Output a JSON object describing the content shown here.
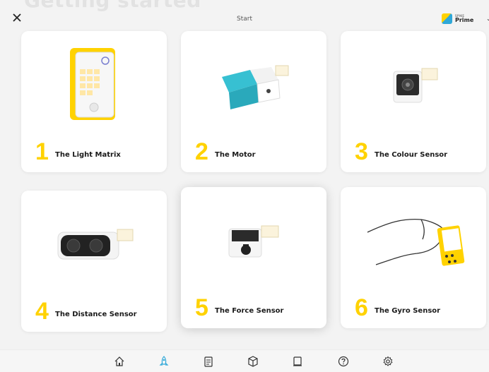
{
  "background_heading": "Getting started",
  "header": {
    "title": "Start",
    "logo_small": "SPIKE",
    "logo_big": "Prime"
  },
  "cards": [
    {
      "number": "1",
      "label": "The Light Matrix"
    },
    {
      "number": "2",
      "label": "The Motor"
    },
    {
      "number": "3",
      "label": "The Colour Sensor"
    },
    {
      "number": "4",
      "label": "The Distance Sensor"
    },
    {
      "number": "5",
      "label": "The Force Sensor"
    },
    {
      "number": "6",
      "label": "The Gyro Sensor"
    }
  ],
  "nav": {
    "icons": [
      "home-icon",
      "rocket-icon",
      "clipboard-icon",
      "box-icon",
      "device-icon",
      "help-icon",
      "settings-icon"
    ],
    "active": "rocket-icon"
  },
  "colors": {
    "accent_yellow": "#ffd200",
    "active_blue": "#2fa8d8",
    "background": "#f3f3f3"
  }
}
